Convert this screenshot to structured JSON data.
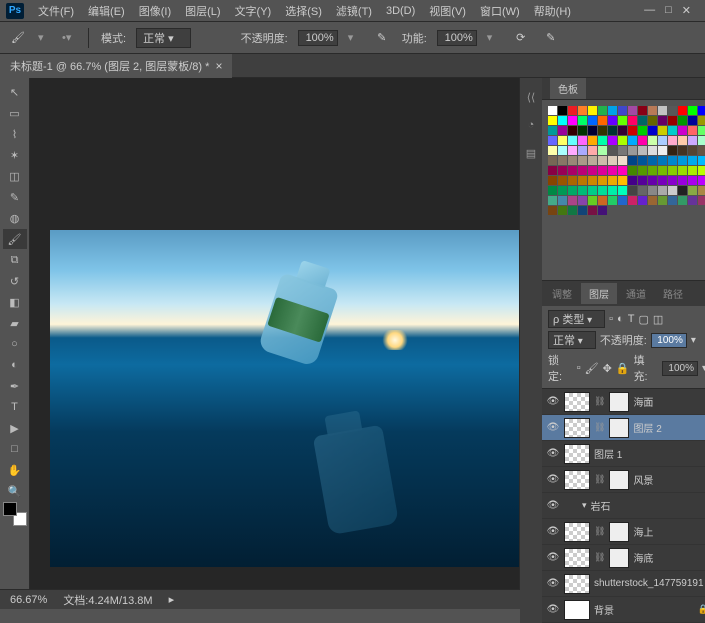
{
  "app": {
    "logo": "Ps"
  },
  "menu": {
    "file": "文件(F)",
    "edit": "编辑(E)",
    "image": "图像(I)",
    "layer": "图层(L)",
    "type": "文字(Y)",
    "select": "选择(S)",
    "filter": "滤镜(T)",
    "view3d": "3D(D)",
    "view": "视图(V)",
    "window": "窗口(W)",
    "help": "帮助(H)"
  },
  "win": {
    "min": "—",
    "restore": "□",
    "close": "✕"
  },
  "options": {
    "mode_label": "模式:",
    "mode_value": "正常",
    "opacity_label": "不透明度:",
    "opacity_value": "100%",
    "flow_label": "功能:",
    "flow_value": "100%"
  },
  "document": {
    "tab_title": "未标题-1 @ 66.7% (图层 2, 图层蒙板/8) *"
  },
  "swatches_panel": {
    "title": "色板"
  },
  "swatch_colors": [
    "#fff",
    "#000",
    "#ed1c24",
    "#ff7f27",
    "#fff200",
    "#22b14c",
    "#00a2e8",
    "#3f48cc",
    "#a349a4",
    "#880015",
    "#b97a57",
    "#c3c3c3",
    "#585858",
    "#f00",
    "#0f0",
    "#00f",
    "#ff0",
    "#0ff",
    "#f0f",
    "#0f6",
    "#06f",
    "#f60",
    "#60f",
    "#6f0",
    "#f06",
    "#066",
    "#660",
    "#606",
    "#900",
    "#090",
    "#009",
    "#990",
    "#099",
    "#909",
    "#300",
    "#030",
    "#003",
    "#330",
    "#033",
    "#303",
    "#c00",
    "#0c0",
    "#00c",
    "#cc0",
    "#0cc",
    "#c0c",
    "#f66",
    "#6f6",
    "#66f",
    "#ff6",
    "#6ff",
    "#f6f",
    "#fa0",
    "#0fa",
    "#a0f",
    "#af0",
    "#0af",
    "#f0a",
    "#cfa",
    "#acf",
    "#fac",
    "#fca",
    "#caf",
    "#afc",
    "#ffa",
    "#aff",
    "#faf",
    "#aaf",
    "#faa",
    "#afa",
    "#555",
    "#777",
    "#999",
    "#bbb",
    "#ddd",
    "#eee",
    "#321",
    "#432",
    "#543",
    "#654",
    "#765",
    "#876",
    "#987",
    "#a98",
    "#ba9",
    "#cba",
    "#dcb",
    "#edc",
    "#048",
    "#059",
    "#06a",
    "#07b",
    "#08c",
    "#09d",
    "#0ae",
    "#0bf",
    "#804",
    "#905",
    "#a06",
    "#b07",
    "#c08",
    "#d09",
    "#e0a",
    "#f0b",
    "#480",
    "#590",
    "#6a0",
    "#7b0",
    "#8c0",
    "#9d0",
    "#ae0",
    "#bf0",
    "#840",
    "#950",
    "#a60",
    "#b70",
    "#c80",
    "#d90",
    "#ea0",
    "#fb0",
    "#408",
    "#509",
    "#60a",
    "#70b",
    "#80c",
    "#90d",
    "#a0e",
    "#b0f",
    "#084",
    "#095",
    "#0a6",
    "#0b7",
    "#0c8",
    "#0d9",
    "#0ea",
    "#0fb",
    "#444",
    "#666",
    "#888",
    "#aaa",
    "#ccc",
    "#222",
    "#8a4",
    "#a84",
    "#4a8",
    "#48a",
    "#a48",
    "#84a",
    "#6c2",
    "#c62",
    "#2c6",
    "#26c",
    "#c26",
    "#62c",
    "#963",
    "#693",
    "#369",
    "#396",
    "#639",
    "#936",
    "#741",
    "#471",
    "#174",
    "#147",
    "#714",
    "#417"
  ],
  "layers_panel": {
    "tabs": {
      "adjust": "调整",
      "layers": "图层",
      "channels": "通道",
      "paths": "路径"
    },
    "kind_label": "ρ 类型",
    "blend_mode": "正常",
    "opacity_label": "不透明度:",
    "opacity_value": "100%",
    "lock_label": "锁定:",
    "fill_label": "填充:",
    "fill_value": "100%",
    "items": [
      {
        "name": "海面",
        "thumb": "checker",
        "mask": true,
        "visible": true
      },
      {
        "name": "图层 2",
        "thumb": "checker",
        "mask": true,
        "visible": true,
        "selected": true
      },
      {
        "name": "图层 1",
        "thumb": "checker",
        "mask": false,
        "visible": true,
        "linked": true
      },
      {
        "name": "风景",
        "thumb": "checker",
        "mask": true,
        "visible": true
      },
      {
        "name": "岩石",
        "thumb": "none",
        "mask": false,
        "visible": true,
        "indent": true
      },
      {
        "name": "海上",
        "thumb": "checker",
        "mask": true,
        "visible": true
      },
      {
        "name": "海底",
        "thumb": "checker",
        "mask": true,
        "visible": true
      },
      {
        "name": "shutterstock_147759191",
        "thumb": "checker",
        "mask": false,
        "visible": true
      },
      {
        "name": "背景",
        "thumb": "white",
        "mask": false,
        "visible": true,
        "locked": true
      }
    ]
  },
  "status": {
    "zoom": "66.67%",
    "docsize": "文档:4.24M/13.8M"
  },
  "tools": [
    {
      "name": "move",
      "glyph": "↖"
    },
    {
      "name": "marquee",
      "glyph": "▭"
    },
    {
      "name": "lasso",
      "glyph": "⌇"
    },
    {
      "name": "wand",
      "glyph": "✶"
    },
    {
      "name": "crop",
      "glyph": "◫"
    },
    {
      "name": "eyedropper",
      "glyph": "✎"
    },
    {
      "name": "spot-heal",
      "glyph": "◍"
    },
    {
      "name": "brush",
      "glyph": "🖌",
      "active": true
    },
    {
      "name": "clone",
      "glyph": "⧉"
    },
    {
      "name": "history-brush",
      "glyph": "↺"
    },
    {
      "name": "eraser",
      "glyph": "◧"
    },
    {
      "name": "gradient",
      "glyph": "▰"
    },
    {
      "name": "blur",
      "glyph": "○"
    },
    {
      "name": "dodge",
      "glyph": "◐"
    },
    {
      "name": "pen",
      "glyph": "✒"
    },
    {
      "name": "type",
      "glyph": "T"
    },
    {
      "name": "path-select",
      "glyph": "▶"
    },
    {
      "name": "rectangle",
      "glyph": "□"
    },
    {
      "name": "hand",
      "glyph": "✋"
    },
    {
      "name": "zoom",
      "glyph": "🔍"
    }
  ]
}
